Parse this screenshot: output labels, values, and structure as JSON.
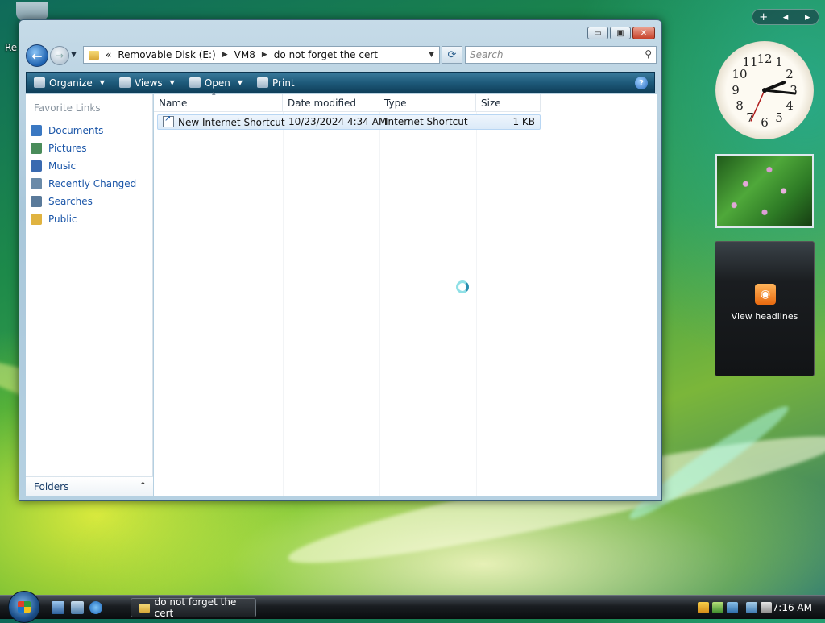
{
  "desktop": {
    "recycle_label": "Re"
  },
  "window": {
    "controls": {
      "minimize": "▭",
      "maximize": "▣",
      "close": "✕"
    },
    "address": {
      "prefix": "«",
      "parts": [
        "Removable Disk (E:)",
        "VM8",
        "do not forget the cert"
      ]
    },
    "search_placeholder": "Search",
    "toolbar": {
      "organize": "Organize",
      "views": "Views",
      "open": "Open",
      "print": "Print",
      "help": "?"
    },
    "sidebar": {
      "title": "Favorite Links",
      "links": [
        {
          "label": "Documents",
          "color": "#3a78c2"
        },
        {
          "label": "Pictures",
          "color": "#4a8c5a"
        },
        {
          "label": "Music",
          "color": "#3a6ab0"
        },
        {
          "label": "Recently Changed",
          "color": "#6a8aa8"
        },
        {
          "label": "Searches",
          "color": "#5a7a9a"
        },
        {
          "label": "Public",
          "color": "#e0b340"
        }
      ],
      "folders_label": "Folders",
      "folders_chevron": "⌃"
    },
    "columns": [
      "Name",
      "Date modified",
      "Type",
      "Size"
    ],
    "rows": [
      {
        "name": "New Internet Shortcut",
        "date": "10/23/2024 4:34 AM",
        "type": "Internet Shortcut",
        "size": "1 KB"
      }
    ]
  },
  "gadgets": {
    "controls": [
      "+",
      "◂",
      "▸"
    ],
    "clock": {
      "hour": 2,
      "minute": 16,
      "second": 34
    },
    "feed": {
      "label": "View headlines",
      "icon": "rss-icon"
    }
  },
  "taskbar": {
    "task_label": "do not forget the cert",
    "time": "7:16 AM"
  },
  "colors": {
    "accent": "#1b56a8",
    "toolbar": "#1e5a7a",
    "selection": "#dbeaf8"
  }
}
